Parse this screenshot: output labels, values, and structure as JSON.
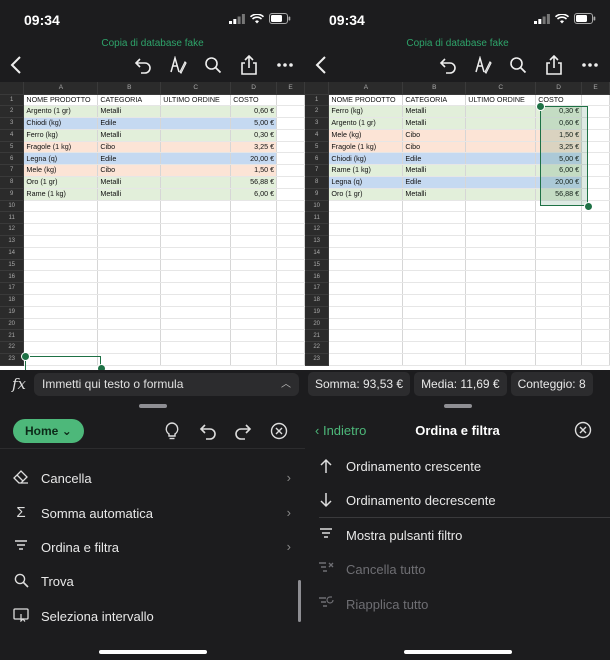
{
  "status": {
    "time_left": "09:34",
    "time_right": "09:34"
  },
  "doc_title": "Copia di database fake",
  "columns": [
    "A",
    "B",
    "C",
    "D",
    "E"
  ],
  "row_numbers": [
    "1",
    "2",
    "3",
    "4",
    "5",
    "6",
    "7",
    "8",
    "9",
    "10",
    "11",
    "12",
    "13",
    "14",
    "15",
    "16",
    "17",
    "18",
    "19",
    "20",
    "21",
    "22",
    "23"
  ],
  "left_sheet": {
    "rows": [
      {
        "cells": [
          "NOME PRODOTTO",
          "CATEGORIA",
          "ULTIMO ORDINE",
          "COSTO",
          ""
        ],
        "color": ""
      },
      {
        "cells": [
          "Argento (1 gr)",
          "Metalli",
          "",
          "0,60 €",
          ""
        ],
        "color": "green"
      },
      {
        "cells": [
          "Chiodi (kg)",
          "Edile",
          "",
          "5,00 €",
          ""
        ],
        "color": "blue"
      },
      {
        "cells": [
          "Ferro (kg)",
          "Metalli",
          "",
          "0,30 €",
          ""
        ],
        "color": "green"
      },
      {
        "cells": [
          "Fragole (1 kg)",
          "Cibo",
          "",
          "3,25 €",
          ""
        ],
        "color": "orange"
      },
      {
        "cells": [
          "Legna (q)",
          "Edile",
          "",
          "20,00 €",
          ""
        ],
        "color": "blue"
      },
      {
        "cells": [
          "Mele (kg)",
          "Cibo",
          "",
          "1,50 €",
          ""
        ],
        "color": "orange"
      },
      {
        "cells": [
          "Oro (1 gr)",
          "Metalli",
          "",
          "56,88 €",
          ""
        ],
        "color": "green"
      },
      {
        "cells": [
          "Rame (1 kg)",
          "Metalli",
          "",
          "6,00 €",
          ""
        ],
        "color": "green"
      }
    ]
  },
  "right_sheet": {
    "rows": [
      {
        "cells": [
          "NOME PRODOTTO",
          "CATEGORIA",
          "ULTIMO ORDINE",
          "COSTO",
          ""
        ],
        "color": ""
      },
      {
        "cells": [
          "Ferro (kg)",
          "Metalli",
          "",
          "0,30 €",
          ""
        ],
        "color": "green"
      },
      {
        "cells": [
          "Argento (1 gr)",
          "Metalli",
          "",
          "0,60 €",
          ""
        ],
        "color": "green"
      },
      {
        "cells": [
          "Mele (kg)",
          "Cibo",
          "",
          "1,50 €",
          ""
        ],
        "color": "orange"
      },
      {
        "cells": [
          "Fragole (1 kg)",
          "Cibo",
          "",
          "3,25 €",
          ""
        ],
        "color": "orange"
      },
      {
        "cells": [
          "Chiodi (kg)",
          "Edile",
          "",
          "5,00 €",
          ""
        ],
        "color": "blue"
      },
      {
        "cells": [
          "Rame (1 kg)",
          "Metalli",
          "",
          "6,00 €",
          ""
        ],
        "color": "green"
      },
      {
        "cells": [
          "Legna (q)",
          "Edile",
          "",
          "20,00 €",
          ""
        ],
        "color": "blue"
      },
      {
        "cells": [
          "Oro (1 gr)",
          "Metalli",
          "",
          "56,88 €",
          ""
        ],
        "color": "green"
      }
    ]
  },
  "formula_bar": {
    "placeholder": "Immetti qui testo o formula"
  },
  "home_menu": {
    "tab_label": "Home",
    "items": [
      {
        "label": "Cancella",
        "icon": "eraser-icon"
      },
      {
        "label": "Somma automatica",
        "icon": "sigma-icon"
      },
      {
        "label": "Ordina e filtra",
        "icon": "filter-icon"
      },
      {
        "label": "Trova",
        "icon": "search-icon"
      },
      {
        "label": "Seleziona intervallo",
        "icon": "select-range-icon"
      }
    ]
  },
  "stats": {
    "sum": "Somma:  93,53 €",
    "avg": "Media:  11,69 €",
    "count": "Conteggio: 8"
  },
  "sort_panel": {
    "back_label": "Indietro",
    "title": "Ordina e filtra",
    "items": [
      {
        "label": "Ordinamento crescente",
        "icon": "arrow-up-icon",
        "enabled": true
      },
      {
        "label": "Ordinamento decrescente",
        "icon": "arrow-down-icon",
        "enabled": true
      },
      {
        "label": "Mostra pulsanti filtro",
        "icon": "filter-icon",
        "enabled": true
      },
      {
        "label": "Cancella tutto",
        "icon": "clear-filter-icon",
        "enabled": false
      },
      {
        "label": "Riapplica tutto",
        "icon": "reapply-filter-icon",
        "enabled": false
      }
    ]
  },
  "colors": {
    "accent": "#4db87a",
    "cell_green": "#e2efda",
    "cell_blue": "#c5d9f1",
    "cell_orange": "#fce4d6",
    "selection": "#1e7145"
  }
}
